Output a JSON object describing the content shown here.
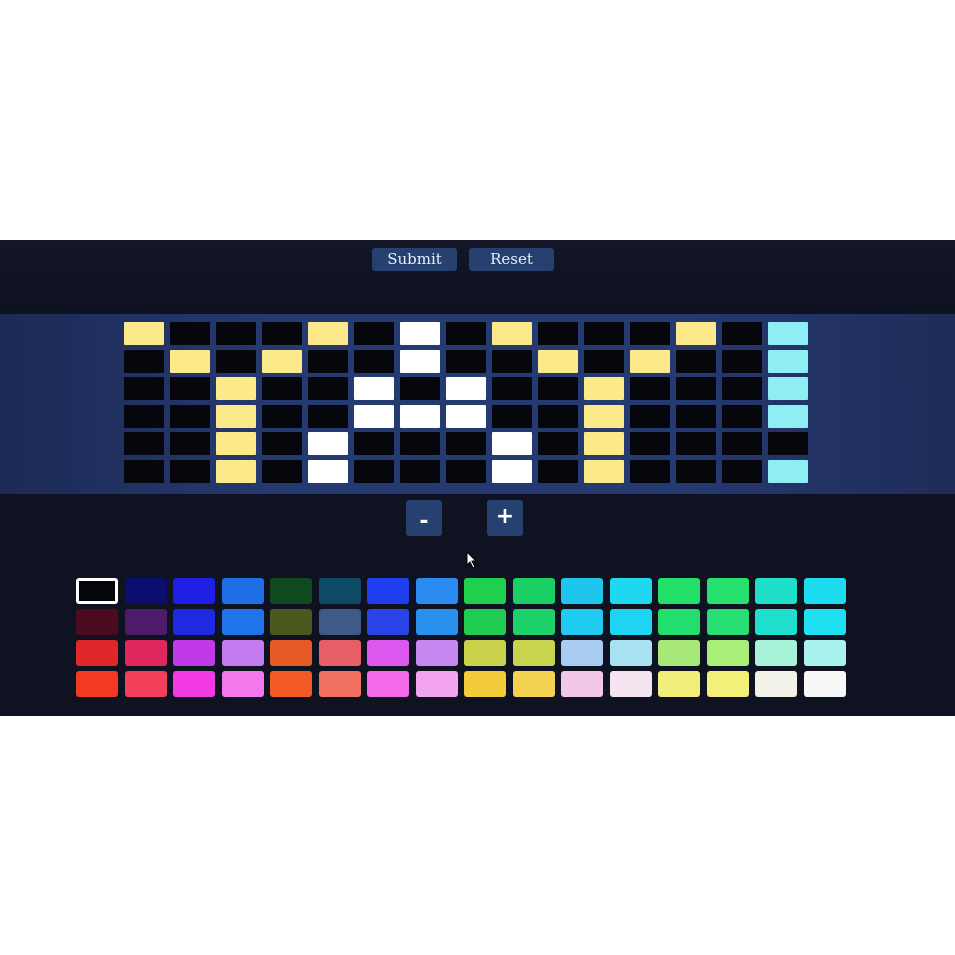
{
  "toolbar": {
    "submit_label": "Submit",
    "reset_label": "Reset"
  },
  "stepper": {
    "minus_label": "-",
    "plus_label": "+"
  },
  "colors": {
    "off": "#05070d",
    "yellow": "#fbe98a",
    "white": "#ffffff",
    "cyan": "#8feef3",
    "button": "#26406f",
    "screen": "#0f1321"
  },
  "grid": {
    "rows": 6,
    "cols": 15,
    "lit": [
      {
        "row": 0,
        "col": 0,
        "color": "yellow"
      },
      {
        "row": 1,
        "col": 1,
        "color": "yellow"
      },
      {
        "row": 2,
        "col": 2,
        "color": "yellow"
      },
      {
        "row": 3,
        "col": 2,
        "color": "yellow"
      },
      {
        "row": 4,
        "col": 2,
        "color": "yellow"
      },
      {
        "row": 5,
        "col": 2,
        "color": "yellow"
      },
      {
        "row": 1,
        "col": 3,
        "color": "yellow"
      },
      {
        "row": 0,
        "col": 4,
        "color": "yellow"
      },
      {
        "row": 4,
        "col": 4,
        "color": "white"
      },
      {
        "row": 5,
        "col": 4,
        "color": "white"
      },
      {
        "row": 2,
        "col": 5,
        "color": "white"
      },
      {
        "row": 3,
        "col": 5,
        "color": "white"
      },
      {
        "row": 0,
        "col": 6,
        "color": "white"
      },
      {
        "row": 1,
        "col": 6,
        "color": "white"
      },
      {
        "row": 3,
        "col": 6,
        "color": "white"
      },
      {
        "row": 2,
        "col": 7,
        "color": "white"
      },
      {
        "row": 3,
        "col": 7,
        "color": "white"
      },
      {
        "row": 0,
        "col": 8,
        "color": "yellow"
      },
      {
        "row": 4,
        "col": 8,
        "color": "white"
      },
      {
        "row": 5,
        "col": 8,
        "color": "white"
      },
      {
        "row": 1,
        "col": 9,
        "color": "yellow"
      },
      {
        "row": 2,
        "col": 10,
        "color": "yellow"
      },
      {
        "row": 3,
        "col": 10,
        "color": "yellow"
      },
      {
        "row": 4,
        "col": 10,
        "color": "yellow"
      },
      {
        "row": 5,
        "col": 10,
        "color": "yellow"
      },
      {
        "row": 1,
        "col": 11,
        "color": "yellow"
      },
      {
        "row": 0,
        "col": 12,
        "color": "yellow"
      },
      {
        "row": 0,
        "col": 14,
        "color": "cyan"
      },
      {
        "row": 1,
        "col": 14,
        "color": "cyan"
      },
      {
        "row": 2,
        "col": 14,
        "color": "cyan"
      },
      {
        "row": 3,
        "col": 14,
        "color": "cyan"
      },
      {
        "row": 5,
        "col": 14,
        "color": "cyan"
      }
    ]
  },
  "palette": {
    "selected": [
      0,
      0
    ],
    "rows": [
      [
        "#05060c",
        "#0b0e6e",
        "#1e1fe3",
        "#1e6fe6",
        "#0e4a1e",
        "#0c4a66",
        "#1e3ef0",
        "#2a8cf0",
        "#1fd04e",
        "#1ad064",
        "#1ec6ee",
        "#1ed8f0",
        "#22e06a",
        "#26e06e",
        "#1ee0c8",
        "#1edcf0"
      ],
      [
        "#4a0c1e",
        "#4e1a6a",
        "#1e2ae0",
        "#1e74e8",
        "#4a5a1e",
        "#3e5a86",
        "#2a44e8",
        "#2a90ee",
        "#20cc50",
        "#1cd06a",
        "#1ecaf0",
        "#1ed4f2",
        "#22de6c",
        "#26de72",
        "#1ee0cc",
        "#1ee0f0"
      ],
      [
        "#e0282a",
        "#e0285e",
        "#c03ae8",
        "#c47af0",
        "#e65a26",
        "#e65e66",
        "#dc58ee",
        "#c488f0",
        "#c8d24a",
        "#c8d44e",
        "#a8ccf2",
        "#a8e2f2",
        "#a8e878",
        "#aaee7a",
        "#a8f2d8",
        "#a8f2f0"
      ],
      [
        "#f23a22",
        "#f2405a",
        "#f23ae4",
        "#f278ec",
        "#f25a26",
        "#f27060",
        "#f26ae8",
        "#f2a4f0",
        "#f2cc3a",
        "#f2d250",
        "#f2c8e8",
        "#f4e4f0",
        "#f2ee7a",
        "#f2f078",
        "#f2f2e8",
        "#f8f8f8"
      ]
    ]
  }
}
